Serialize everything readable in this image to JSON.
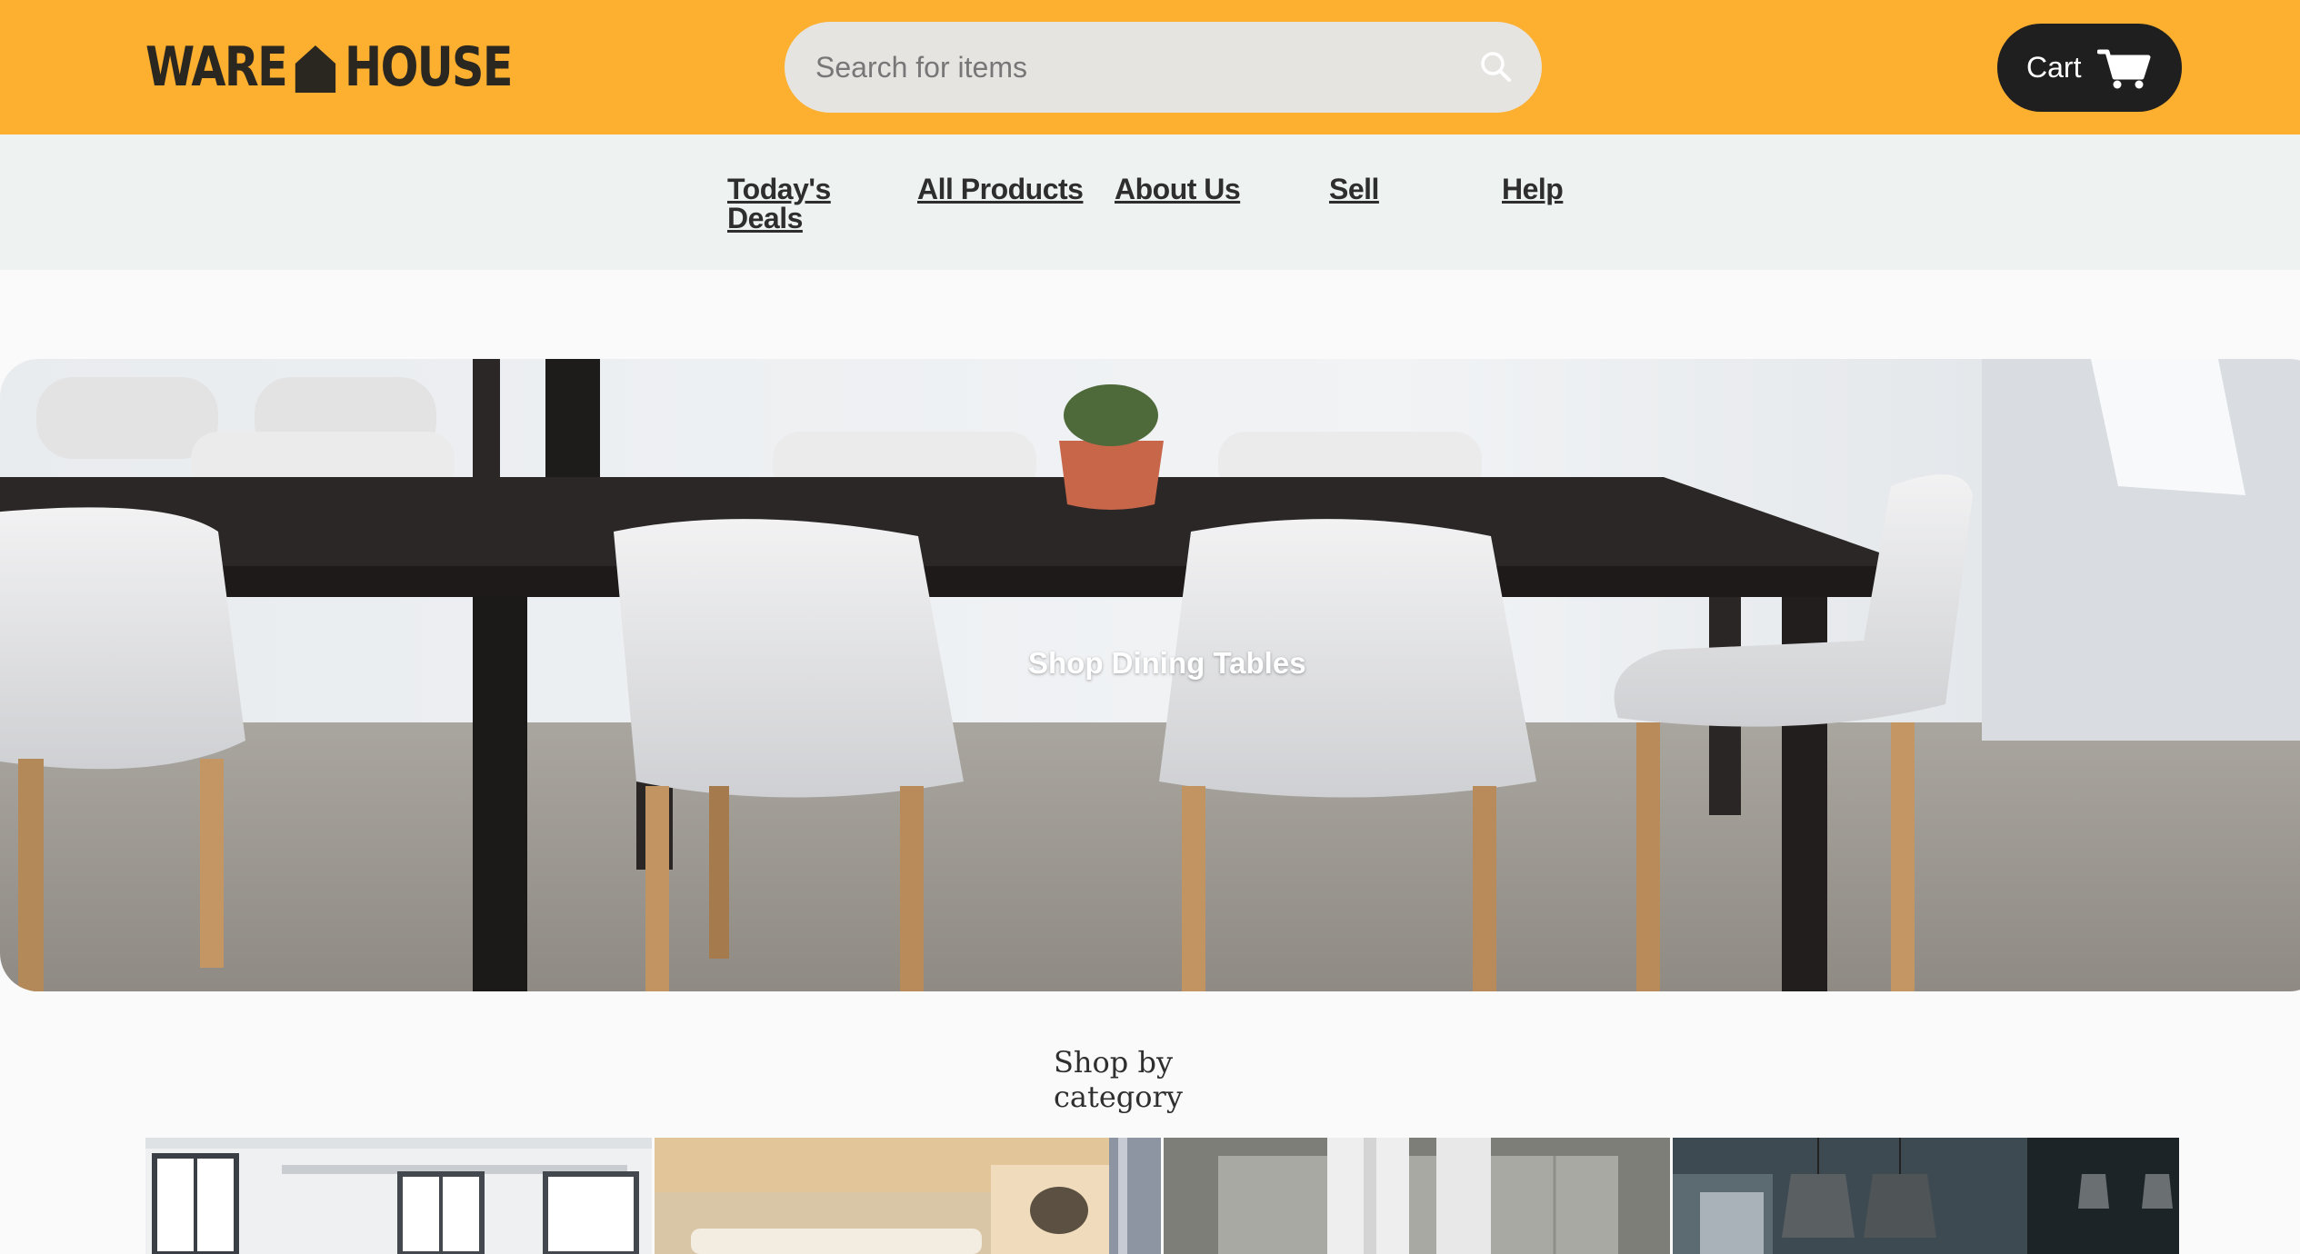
{
  "header": {
    "logo_left": "WARE",
    "logo_right": "HOUSE",
    "search_placeholder": "Search for items",
    "cart_label": "Cart"
  },
  "nav": {
    "items": [
      {
        "label": "Today's Deals"
      },
      {
        "label": "All Products"
      },
      {
        "label": "About Us"
      },
      {
        "label": "Sell"
      },
      {
        "label": "Help"
      }
    ]
  },
  "hero": {
    "caption": "Shop Dining Tables"
  },
  "category": {
    "title": "Shop by category"
  },
  "colors": {
    "header_bg": "#fdaf2f",
    "nav_bg": "#eef3f2",
    "cart_bg": "#1f1f1f",
    "page_bg": "#fafafa"
  }
}
